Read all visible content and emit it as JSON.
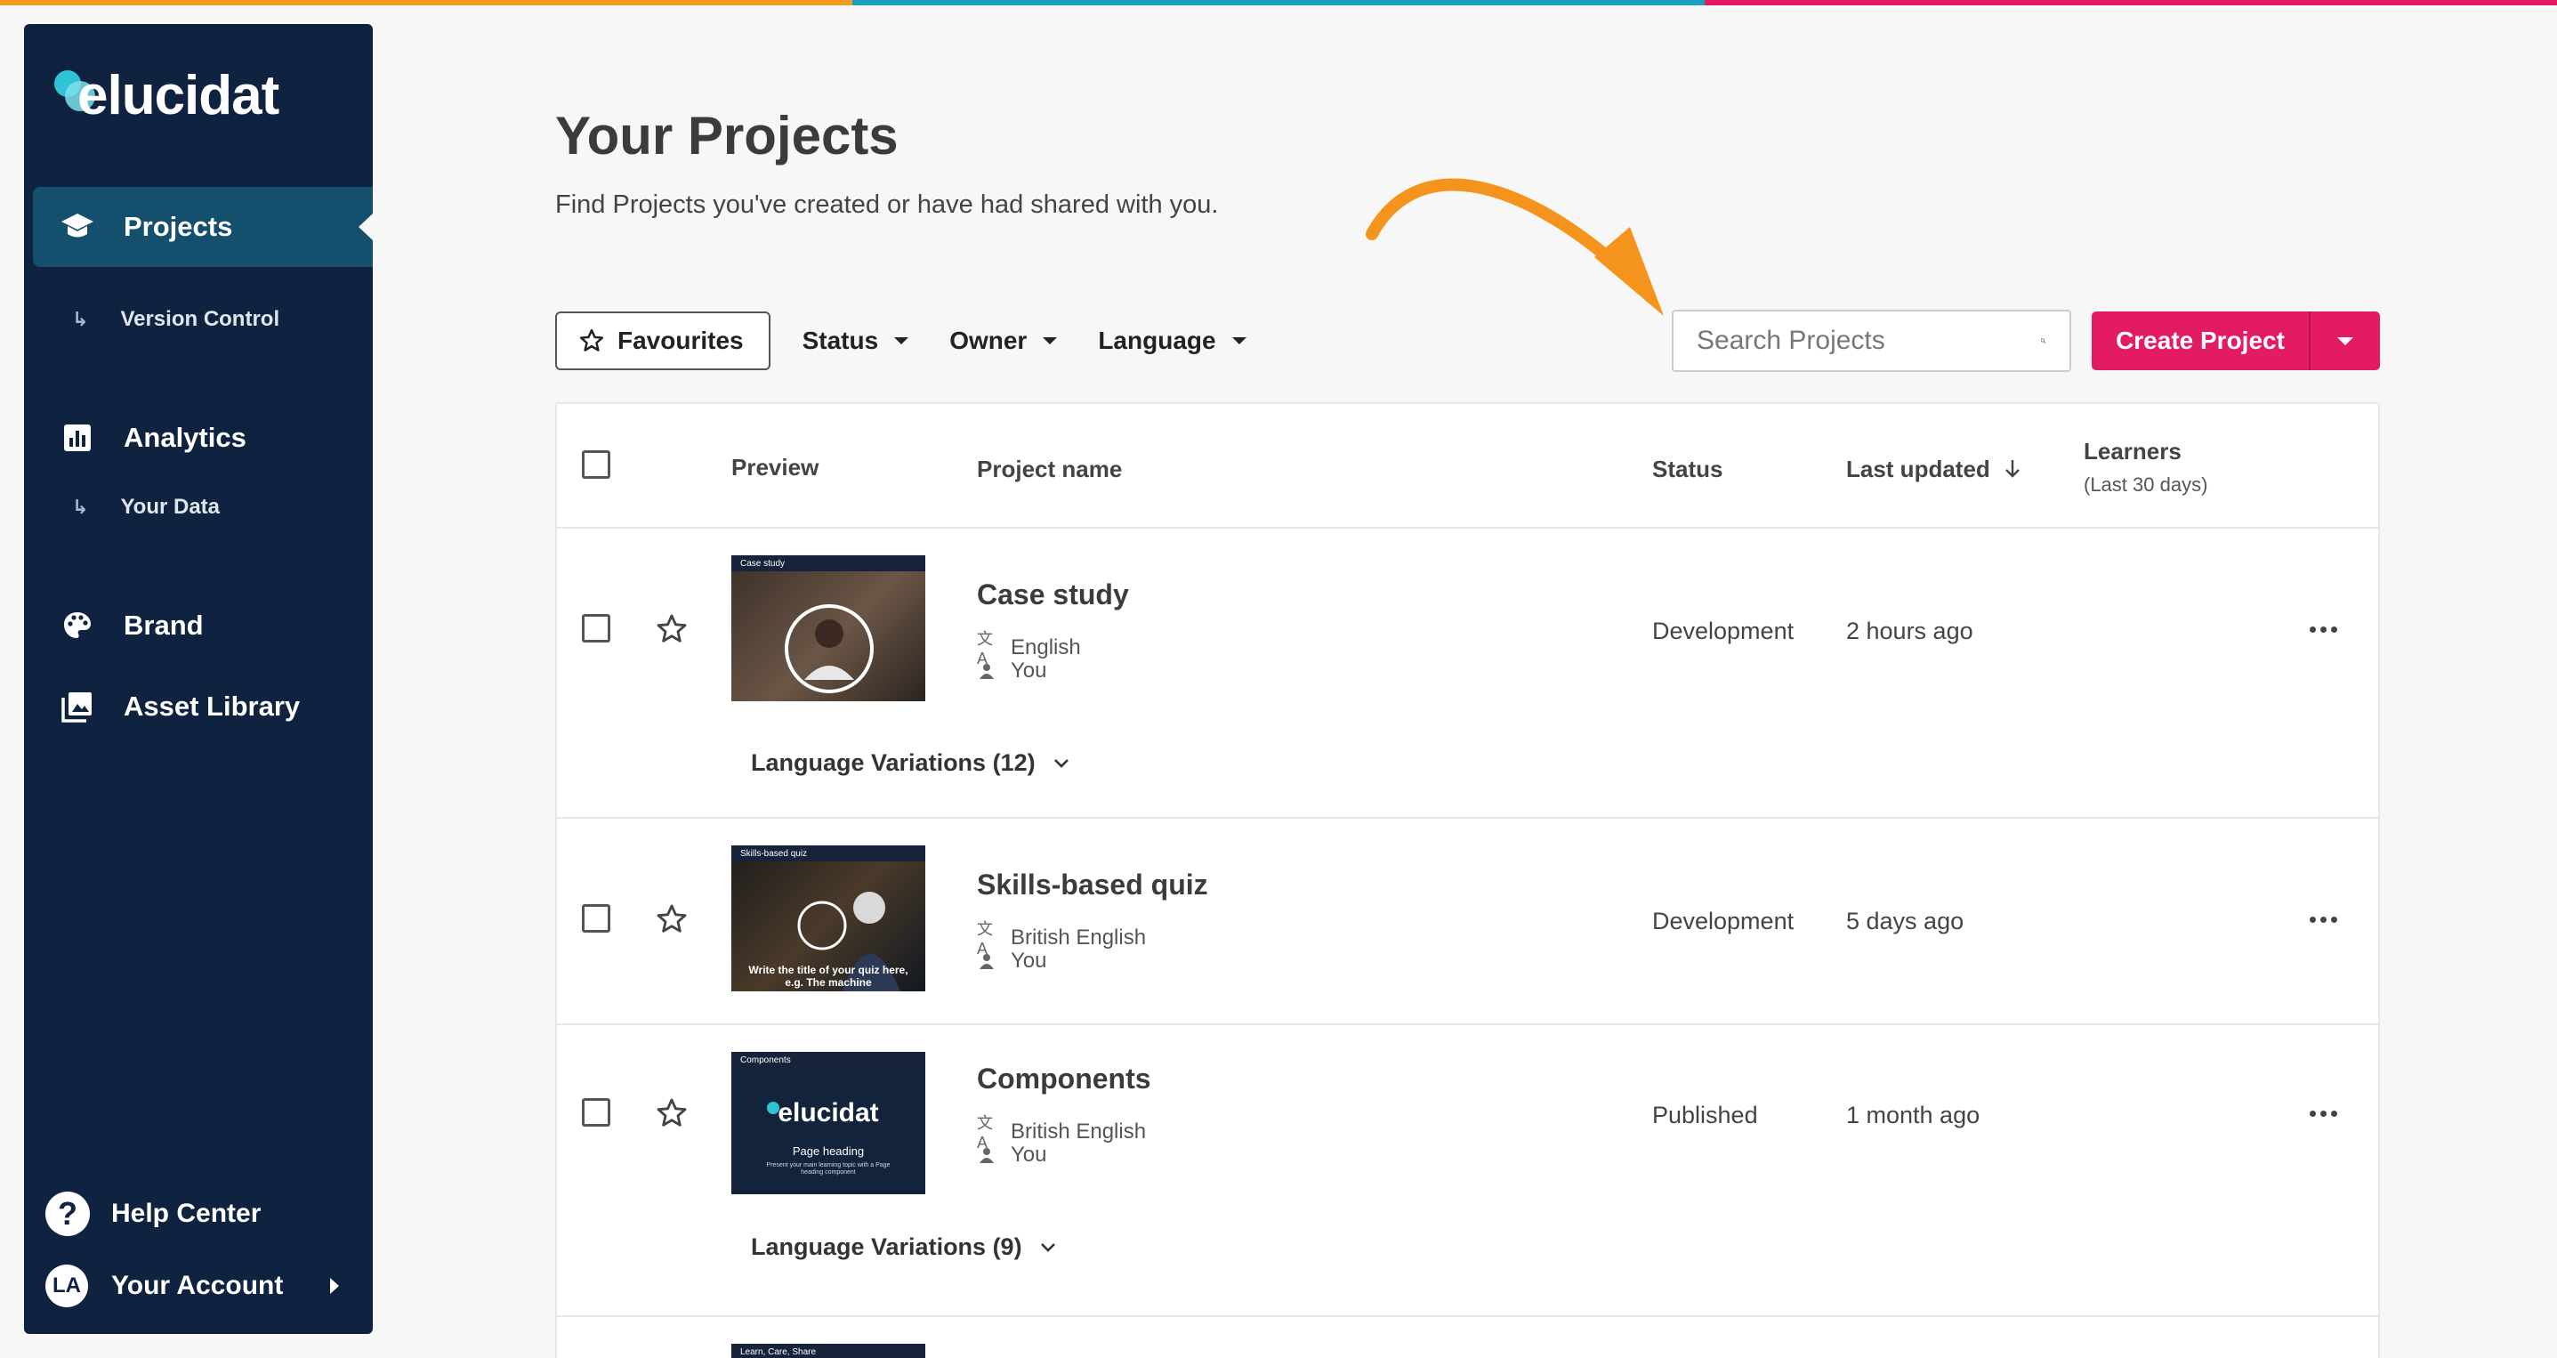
{
  "colors": {
    "accent_orange": "#f39a21",
    "accent_teal": "#1aa0bf",
    "accent_pink": "#e21b64",
    "sidebar_bg": "#0f2340",
    "primary_button": "#e21b64"
  },
  "sidebar": {
    "logo_text": "elucidat",
    "nav": [
      {
        "label": "Projects",
        "icon": "graduation-cap-icon"
      },
      {
        "label": "Version Control",
        "sub": true
      },
      {
        "label": "Analytics",
        "icon": "bar-chart-icon"
      },
      {
        "label": "Your Data",
        "sub": true
      },
      {
        "label": "Brand",
        "icon": "palette-icon"
      },
      {
        "label": "Asset Library",
        "icon": "image-library-icon"
      }
    ],
    "help_label": "Help Center",
    "help_icon": "?",
    "account_label": "Your Account",
    "account_initials": "LA"
  },
  "header": {
    "title": "Your Projects",
    "subtitle": "Find Projects you've created or have had shared with you."
  },
  "filters": {
    "favourites": "Favourites",
    "status": "Status",
    "owner": "Owner",
    "language": "Language"
  },
  "search": {
    "placeholder": "Search Projects"
  },
  "create_button": "Create Project",
  "table": {
    "columns": {
      "preview": "Preview",
      "project_name": "Project name",
      "status": "Status",
      "last_updated": "Last updated",
      "learners": "Learners",
      "learners_sub": "(Last 30 days)"
    },
    "rows": [
      {
        "name": "Case study",
        "language": "English",
        "owner": "You",
        "status": "Development",
        "updated": "2 hours ago",
        "thumb_label": "Case study",
        "variations": "Language Variations (12)"
      },
      {
        "name": "Skills-based quiz",
        "language": "British English",
        "owner": "You",
        "status": "Development",
        "updated": "5 days ago",
        "thumb_label": "Skills-based quiz",
        "thumb_caption": "Write the title of your quiz here, e.g. The machine"
      },
      {
        "name": "Components",
        "language": "British English",
        "owner": "You",
        "status": "Published",
        "updated": "1 month ago",
        "thumb_label": "Components",
        "thumb_logo": "elucidat",
        "thumb_heading": "Page heading",
        "thumb_small": "Present your main learning topic with a Page heading component",
        "variations": "Language Variations (9)"
      },
      {
        "thumb_label": "Learn, Care, Share"
      }
    ]
  }
}
